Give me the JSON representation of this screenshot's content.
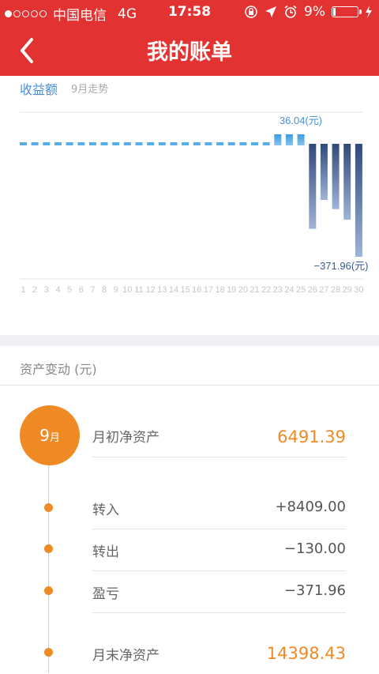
{
  "status_bar": {
    "signal_dots": 5,
    "signal_filled": 1,
    "carrier": "中国电信",
    "network": "4G",
    "time": "17:58",
    "battery": "9%"
  },
  "header": {
    "title": "我的账单"
  },
  "chart": {
    "title": "收益额",
    "subtitle": "9月走势",
    "max_label": "36.04(元)",
    "min_label": "−371.96(元)"
  },
  "chart_data": {
    "type": "bar",
    "categories": [
      "1",
      "2",
      "3",
      "4",
      "5",
      "6",
      "7",
      "8",
      "9",
      "10",
      "11",
      "12",
      "13",
      "14",
      "15",
      "16",
      "17",
      "18",
      "19",
      "20",
      "21",
      "22",
      "23",
      "24",
      "25",
      "26",
      "27",
      "28",
      "29",
      "30"
    ],
    "values": [
      0,
      0,
      0,
      0,
      0,
      0,
      0,
      0,
      0,
      0,
      0,
      0,
      0,
      0,
      0,
      0,
      0,
      0,
      0,
      0,
      0,
      0,
      36.04,
      36.04,
      36.04,
      -280,
      -185,
      -215,
      -250,
      -371.96
    ],
    "title": "收益额",
    "subtitle": "9月走势",
    "annotations": [
      "36.04(元)",
      "−371.96(元)"
    ],
    "colors": {
      "positive": "#5aaee6",
      "negative": "#3c5a8c"
    }
  },
  "assets": {
    "section_title": "资产变动 (元)",
    "month_number": "9",
    "month_unit": "月",
    "rows": [
      {
        "label": "月初净资产",
        "value": "6491.39"
      },
      {
        "label": "转入",
        "value": "+8409.00"
      },
      {
        "label": "转出",
        "value": "−130.00"
      },
      {
        "label": "盈亏",
        "value": "−371.96"
      },
      {
        "label": "月末净资产",
        "value": "14398.43"
      }
    ]
  },
  "colors": {
    "header": "#e23232",
    "accent": "#f08a24",
    "chart_blue": "#4a90d9"
  }
}
